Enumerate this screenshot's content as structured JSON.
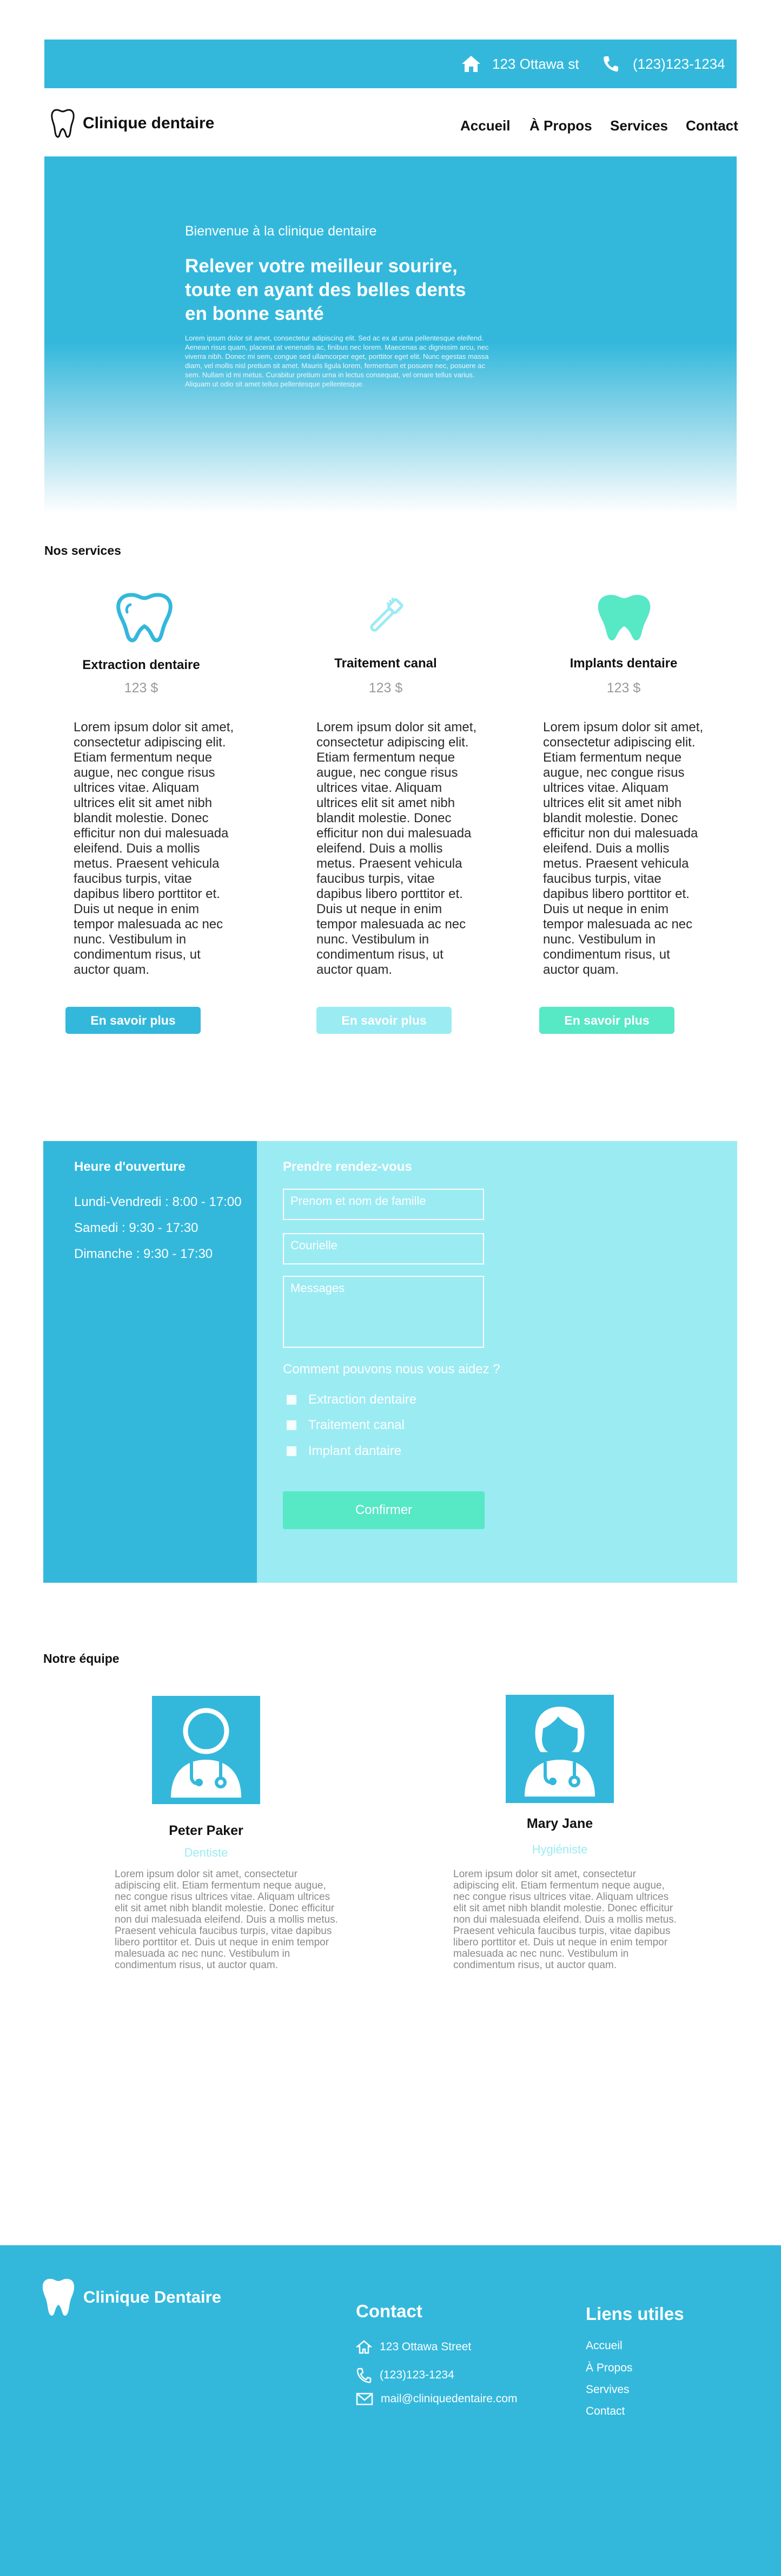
{
  "topbar": {
    "address": "123  Ottawa  st",
    "phone": "(123)123-1234",
    "icons": [
      "home-icon",
      "phone-icon"
    ]
  },
  "header": {
    "brand": "Clinique dentaire",
    "nav": [
      "Accueil",
      "À Propos",
      "Services",
      "Contact"
    ]
  },
  "hero": {
    "kicker": "Bienvenue à la clinique dentaire",
    "title": "Relever votre meilleur sourire, toute en ayant des belles dents en bonne santé",
    "body": "Lorem ipsum dolor sit amet, consectetur adipiscing elit. Sed ac ex at urna pellentesque eleifend. Aenean risus quam, placerat at venenatis ac, finibus nec lorem. Maecenas ac dignissim arcu, nec viverra nibh. Donec mi sem, congue sed ullamcorper eget, porttitor eget elit. Nunc egestas massa diam, vel mollis nisl pretium sit amet. Mauris ligula lorem, fermentum et posuere nec, posuere ac sem. Nullam id mi metus. Curabitur pretium urna in lectus consequat, vel ornare tellus varius. Aliquam ut odio sit amet tellus pellentesque pellentesque."
  },
  "services": {
    "title": "Nos services",
    "items": [
      {
        "name": "Extraction dentaire",
        "price": "123 $",
        "icon": "tooth-outline-icon",
        "button": "En savoir plus",
        "button_color": "#33b8dc"
      },
      {
        "name": "Traitement canal",
        "price": "123 $",
        "icon": "toothbrush-icon",
        "button": "En savoir plus",
        "button_color": "#9bebf3"
      },
      {
        "name": "Implants dentaire",
        "price": "123 $",
        "icon": "tooth-filled-icon",
        "button": "En savoir plus",
        "button_color": "#57e8c6"
      }
    ],
    "description": "Lorem ipsum dolor sit amet, consectetur adipiscing elit. Etiam fermentum neque augue, nec congue risus ultrices vitae. Aliquam ultrices elit sit amet nibh blandit molestie. Donec efficitur non dui malesuada eleifend. Duis a mollis metus. Praesent vehicula faucibus turpis, vitae dapibus libero porttitor et. Duis ut neque in enim tempor malesuada ac nec nunc. Vestibulum in condimentum risus, ut auctor quam."
  },
  "appointment": {
    "hours_title": "Heure d'ouverture",
    "hours": [
      "Lundi-Vendredi : 8:00 - 17:00",
      "Samedi : 9:30 - 17:30",
      "Dimanche : 9:30 - 17:30"
    ],
    "form_title": "Prendre  rendez-vous",
    "name_placeholder": "Prenom et nom de famille",
    "email_placeholder": "Courielle",
    "message_placeholder": "Messages",
    "question": "Comment pouvons nous vous aidez ?",
    "options": [
      "Extraction dentaire",
      "Traitement canal",
      "Implant dantaire"
    ],
    "submit": "Confirmer",
    "colors": {
      "hours_bg": "#33b8dc",
      "form_bg": "#9bebf3",
      "submit_bg": "#57e8c6"
    }
  },
  "team": {
    "title": "Notre équipe",
    "members": [
      {
        "name": "Peter Paker",
        "role": "Dentiste",
        "avatar_icon": "doctor-male-icon"
      },
      {
        "name": "Mary Jane",
        "role": "Hygiéniste",
        "avatar_icon": "doctor-female-icon"
      }
    ],
    "bio": "Lorem ipsum dolor sit amet, consectetur adipiscing elit. Etiam fermentum neque augue, nec congue risus ultrices vitae. Aliquam ultrices elit sit amet nibh blandit molestie. Donec efficitur non dui malesuada eleifend. Duis a mollis metus. Praesent vehicula faucibus turpis, vitae dapibus libero porttitor et. Duis ut neque in enim tempor malesuada ac nec nunc. Vestibulum in condimentum risus, ut auctor quam."
  },
  "footer": {
    "brand": "Clinique Dentaire",
    "contact_title": "Contact",
    "address": "123 Ottawa Street",
    "phone": "(123)123-1234",
    "email": "mail@cliniquedentaire.com",
    "links_title": "Liens utiles",
    "links": [
      "Accueil",
      "À Propos",
      "Servives",
      "Contact"
    ],
    "icons": [
      "tooth-logo-icon",
      "home-icon",
      "phone-icon",
      "mail-icon"
    ]
  },
  "colors": {
    "primary": "#33b8dc",
    "light": "#9bebf3",
    "mint": "#57e8c6"
  }
}
